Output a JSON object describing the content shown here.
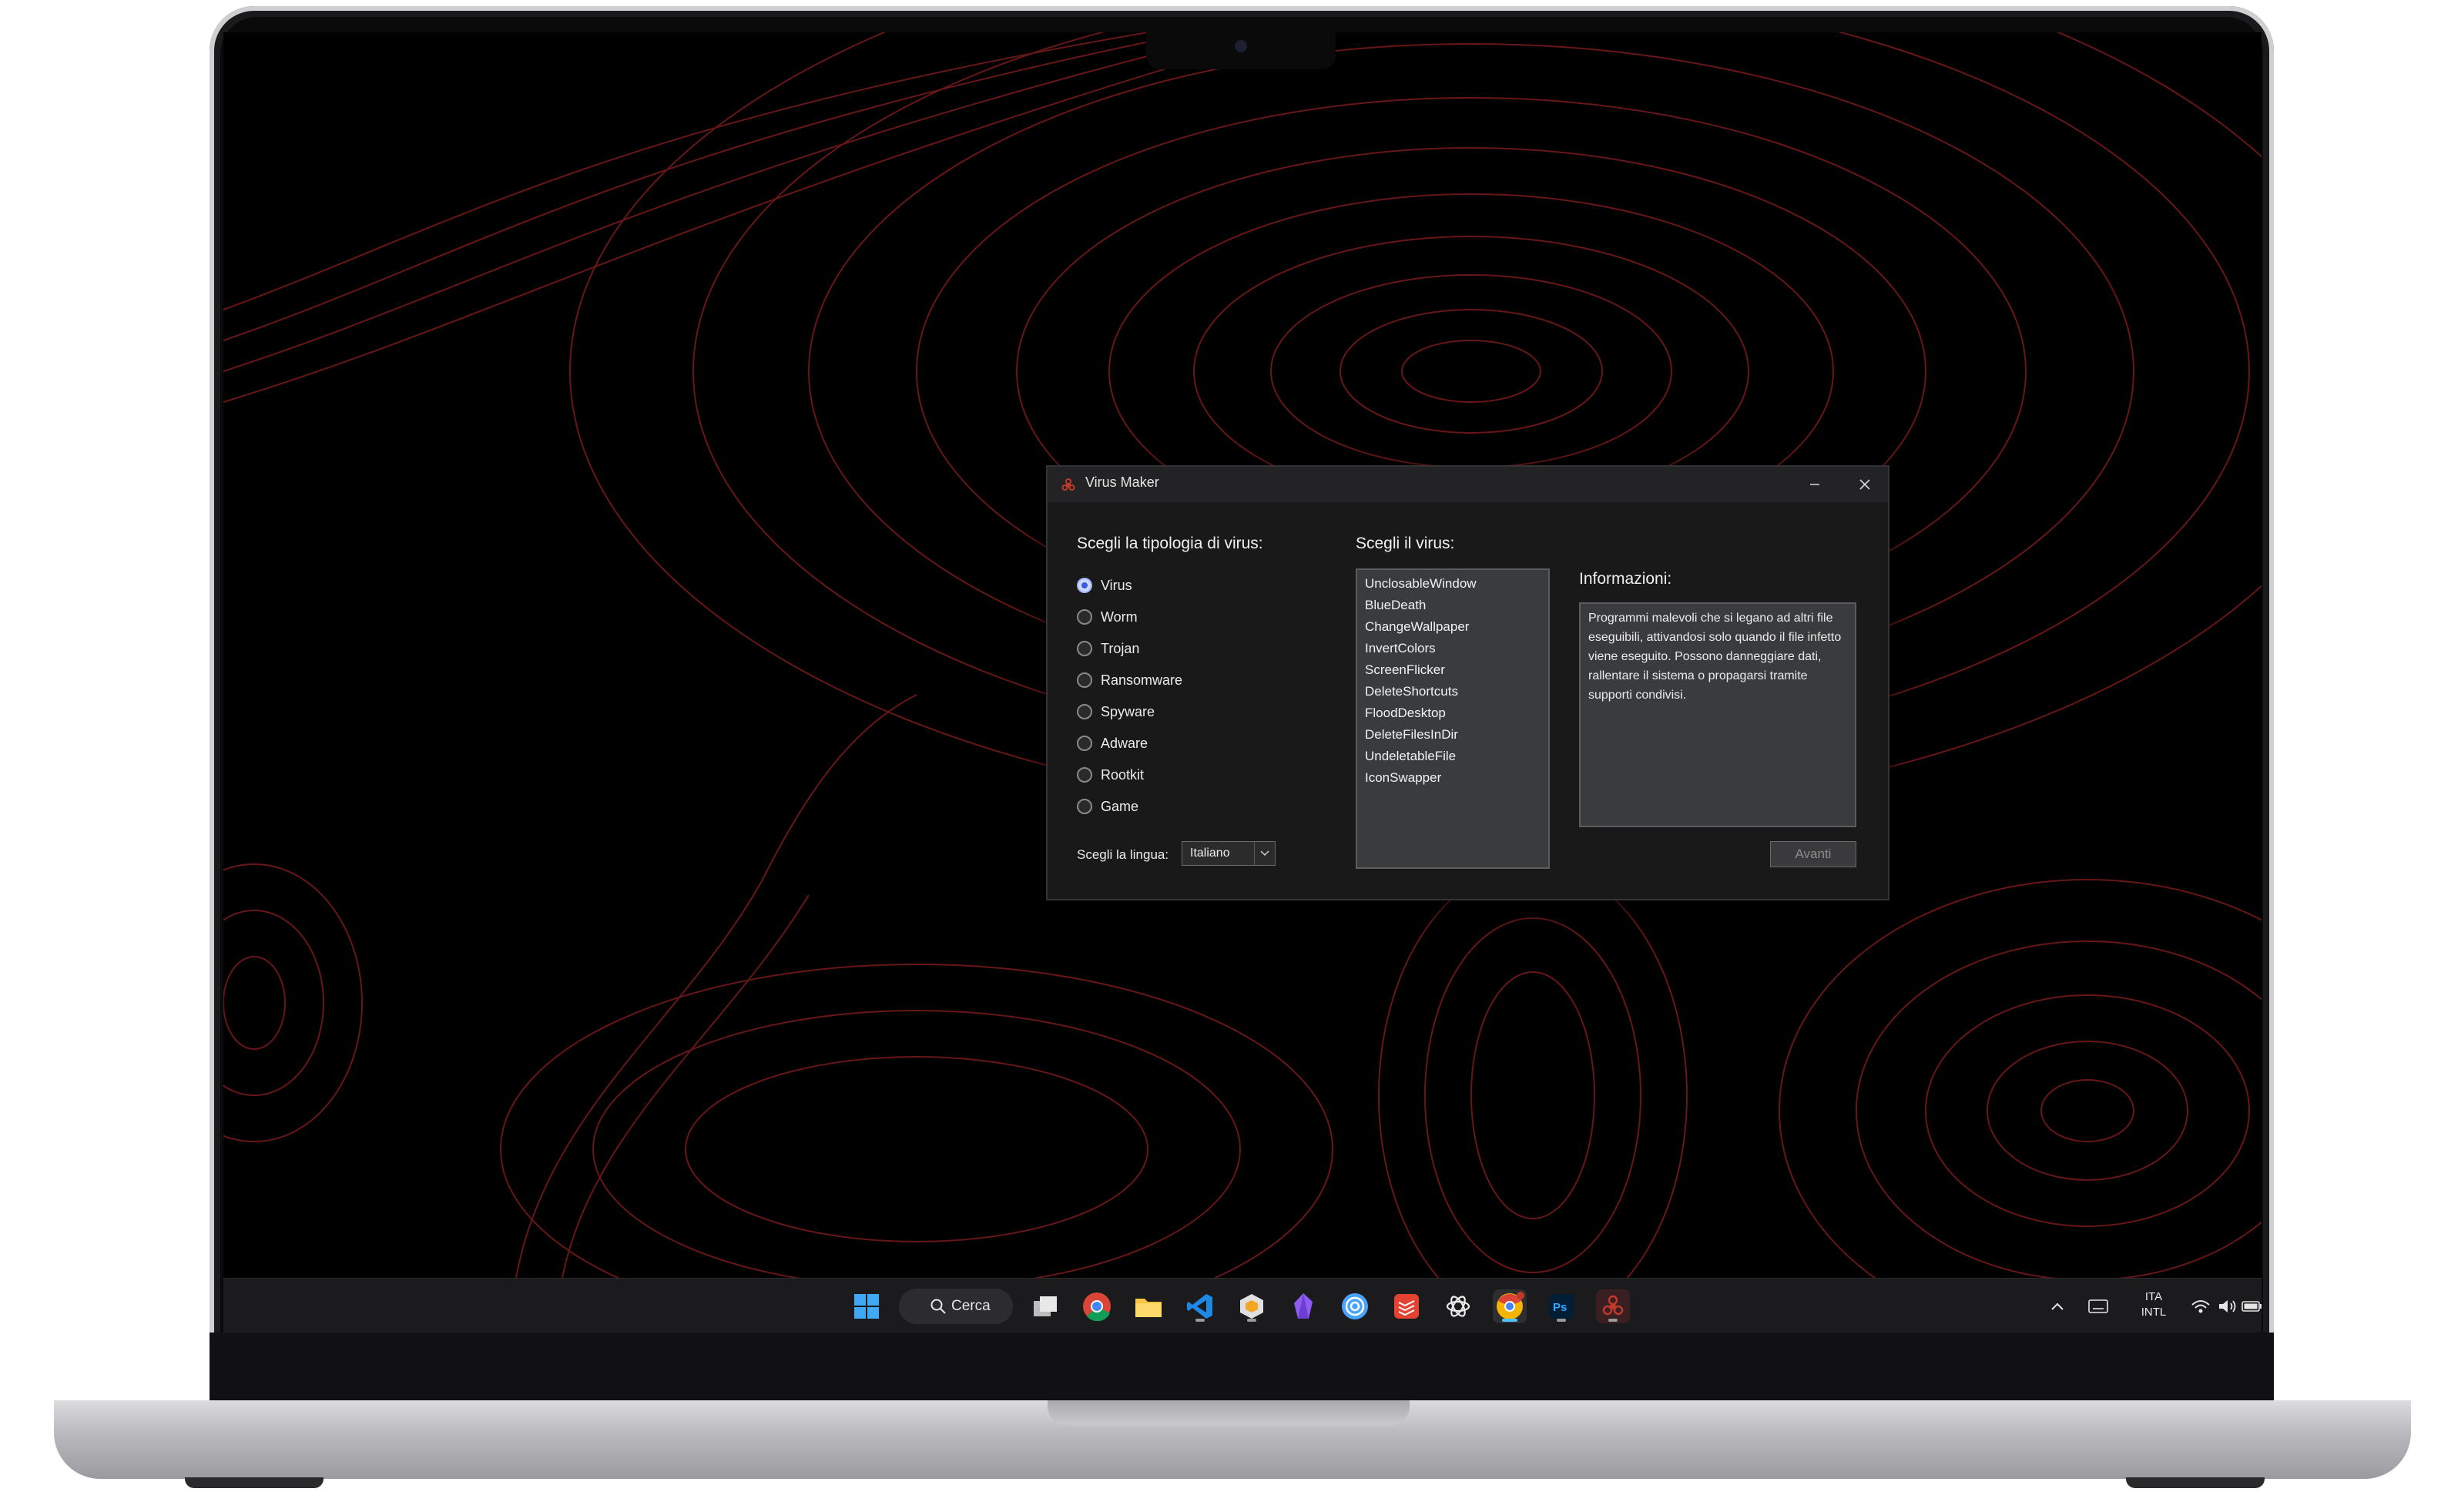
{
  "window": {
    "title": "Virus Maker"
  },
  "type_section": {
    "heading": "Scegli la tipologia di virus:",
    "options": [
      "Virus",
      "Worm",
      "Trojan",
      "Ransomware",
      "Spyware",
      "Adware",
      "Rootkit",
      "Game"
    ],
    "selected": "Virus"
  },
  "virus_section": {
    "heading": "Scegli il virus:",
    "items": [
      "UnclosableWindow",
      "BlueDeath",
      "ChangeWallpaper",
      "InvertColors",
      "ScreenFlicker",
      "DeleteShortcuts",
      "FloodDesktop",
      "DeleteFilesInDir",
      "UndeletableFile",
      "IconSwapper"
    ]
  },
  "info_section": {
    "heading": "Informazioni:",
    "text": "Programmi malevoli che si legano ad altri file eseguibili, attivandosi solo quando il file infetto viene eseguito. Possono danneggiare dati, rallentare il sistema o propagarsi tramite supporti condivisi."
  },
  "language": {
    "label": "Scegli la lingua:",
    "value": "Italiano"
  },
  "buttons": {
    "next": "Avanti"
  },
  "taskbar": {
    "search_label": "Cerca",
    "apps": [
      "windows-start-icon",
      "task-view-icon",
      "chrome-icon",
      "file-explorer-icon",
      "vscode-icon",
      "cube-app-icon",
      "obsidian-icon",
      "network-app-icon",
      "todoist-icon",
      "chatgpt-icon",
      "chrome-canary-icon",
      "photoshop-icon",
      "virus-maker-icon"
    ],
    "tray": {
      "lang_top": "ITA",
      "lang_bottom": "INTL"
    }
  },
  "colors": {
    "accent": "#c0392b",
    "window_bg": "#191919",
    "wallpaper_lines": "#8a1f1f"
  }
}
